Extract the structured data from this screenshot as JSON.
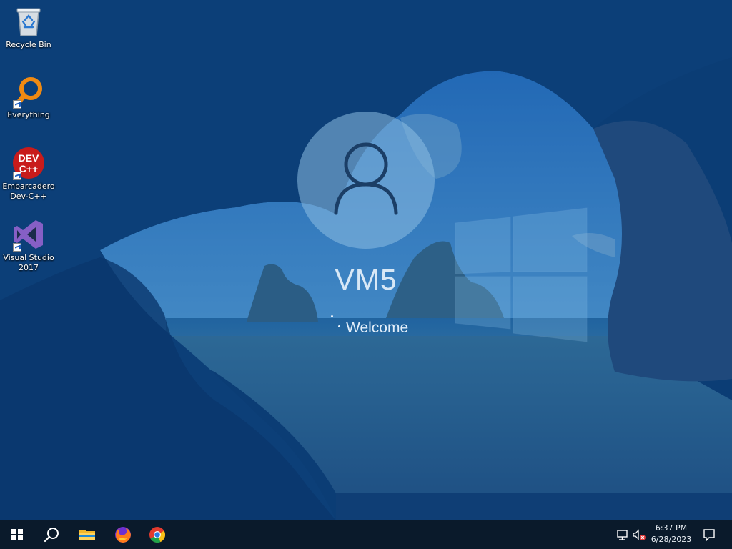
{
  "desktop": {
    "icons": [
      {
        "label": "Recycle Bin",
        "icon": "recycle-bin-icon"
      },
      {
        "label": "Everything",
        "icon": "everything-search-icon"
      },
      {
        "label": "Embarcadero\nDev-C++",
        "icon": "dev-cpp-icon",
        "badge": "DEV\nC++"
      },
      {
        "label": "Visual Studio\n2017",
        "icon": "visual-studio-icon"
      }
    ]
  },
  "lock_screen": {
    "user_name": "VM5",
    "status": "Welcome"
  },
  "taskbar": {
    "pinned": [
      "start-button",
      "search-button",
      "file-explorer",
      "firefox",
      "chrome"
    ],
    "tray": {
      "time": "6:37 PM",
      "date": "6/28/2023"
    }
  },
  "colors": {
    "overlay": "#0b3f78",
    "taskbar": "#0a1a2b"
  }
}
